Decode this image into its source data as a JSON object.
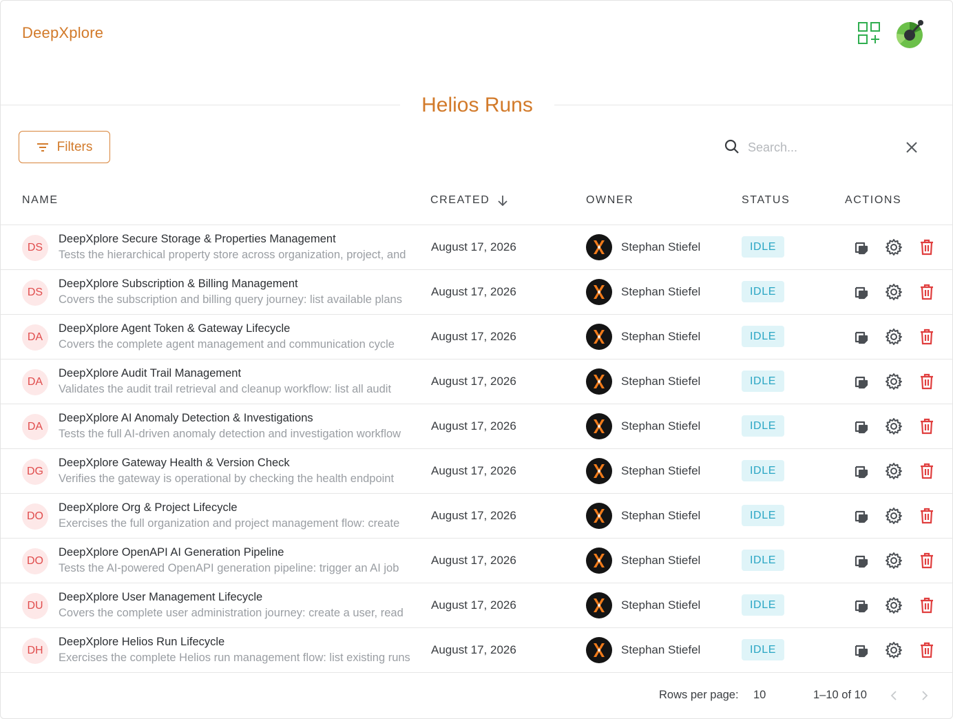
{
  "app": {
    "brand": "DeepXplore"
  },
  "page": {
    "title": "Helios Runs"
  },
  "toolbar": {
    "filters_label": "Filters"
  },
  "search": {
    "placeholder": "Search..."
  },
  "table": {
    "columns": {
      "name": "NAME",
      "created": "CREATED",
      "owner": "OWNER",
      "status": "STATUS",
      "actions": "ACTIONS"
    },
    "sort": {
      "column": "created",
      "direction": "descending"
    },
    "rows": [
      {
        "initials": "DS",
        "name": "DeepXplore Secure Storage & Properties Management",
        "description": "Tests the hierarchical property store across organization, project, and",
        "created": "August 17, 2026",
        "owner": "Stephan Stiefel",
        "status": "IDLE"
      },
      {
        "initials": "DS",
        "name": "DeepXplore Subscription & Billing Management",
        "description": "Covers the subscription and billing query journey: list available plans",
        "created": "August 17, 2026",
        "owner": "Stephan Stiefel",
        "status": "IDLE"
      },
      {
        "initials": "DA",
        "name": "DeepXplore Agent Token & Gateway Lifecycle",
        "description": "Covers the complete agent management and communication cycle",
        "created": "August 17, 2026",
        "owner": "Stephan Stiefel",
        "status": "IDLE"
      },
      {
        "initials": "DA",
        "name": "DeepXplore Audit Trail Management",
        "description": "Validates the audit trail retrieval and cleanup workflow: list all audit",
        "created": "August 17, 2026",
        "owner": "Stephan Stiefel",
        "status": "IDLE"
      },
      {
        "initials": "DA",
        "name": "DeepXplore AI Anomaly Detection & Investigations",
        "description": "Tests the full AI-driven anomaly detection and investigation workflow",
        "created": "August 17, 2026",
        "owner": "Stephan Stiefel",
        "status": "IDLE"
      },
      {
        "initials": "DG",
        "name": "DeepXplore Gateway Health & Version Check",
        "description": "Verifies the gateway is operational by checking the health endpoint",
        "created": "August 17, 2026",
        "owner": "Stephan Stiefel",
        "status": "IDLE"
      },
      {
        "initials": "DO",
        "name": "DeepXplore Org & Project Lifecycle",
        "description": "Exercises the full organization and project management flow: create",
        "created": "August 17, 2026",
        "owner": "Stephan Stiefel",
        "status": "IDLE"
      },
      {
        "initials": "DO",
        "name": "DeepXplore OpenAPI AI Generation Pipeline",
        "description": "Tests the AI-powered OpenAPI generation pipeline: trigger an AI job",
        "created": "August 17, 2026",
        "owner": "Stephan Stiefel",
        "status": "IDLE"
      },
      {
        "initials": "DU",
        "name": "DeepXplore User Management Lifecycle",
        "description": "Covers the complete user administration journey: create a user, read",
        "created": "August 17, 2026",
        "owner": "Stephan Stiefel",
        "status": "IDLE"
      },
      {
        "initials": "DH",
        "name": "DeepXplore Helios Run Lifecycle",
        "description": "Exercises the complete Helios run management flow: list existing runs",
        "created": "August 17, 2026",
        "owner": "Stephan Stiefel",
        "status": "IDLE"
      }
    ],
    "row_actions": [
      "copy-icon",
      "gear-icon",
      "trash-icon"
    ]
  },
  "pagination": {
    "rows_per_page_label": "Rows per page:",
    "rows_per_page": "10",
    "range": "1–10 of 10"
  },
  "colors": {
    "brand": "#d27a2a",
    "status_idle_bg": "#dff4f8",
    "status_idle_text": "#2aa6c4",
    "delete": "#e03e3e",
    "avatar_bg": "#fde8e8",
    "avatar_text": "#e04c4c"
  },
  "icons": {
    "apps": "apps-add-icon",
    "user": "user-avatar-icon",
    "search": "search-icon",
    "clear": "close-icon",
    "filter": "filter-icon",
    "sort": "arrow-down-icon"
  }
}
